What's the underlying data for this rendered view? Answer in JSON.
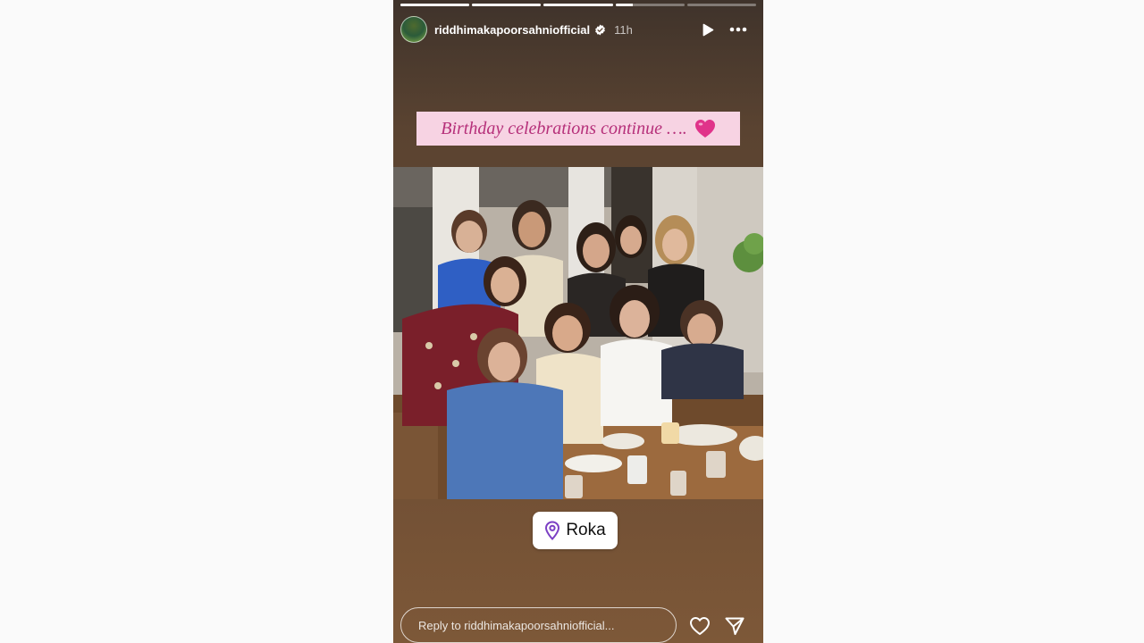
{
  "story": {
    "progress": [
      1,
      1,
      1,
      0.25,
      0
    ],
    "username": "riddhimakapoorsahniofficial",
    "time_ago": "11h",
    "caption": "Birthday celebrations continue ….",
    "location": "Roka",
    "reply_placeholder": "Reply to riddhimakapoorsahniofficial...",
    "icons": {
      "verified": "verified-badge-icon",
      "play": "play-icon",
      "more": "more-options-icon",
      "heart_emoji": "pink-heart-emoji",
      "location": "location-pin-icon",
      "like": "heart-icon",
      "share": "send-icon"
    },
    "colors": {
      "caption_bg": "#f7d3e3",
      "caption_text": "#b6307a",
      "location_pin": "#7b3fc4"
    }
  }
}
